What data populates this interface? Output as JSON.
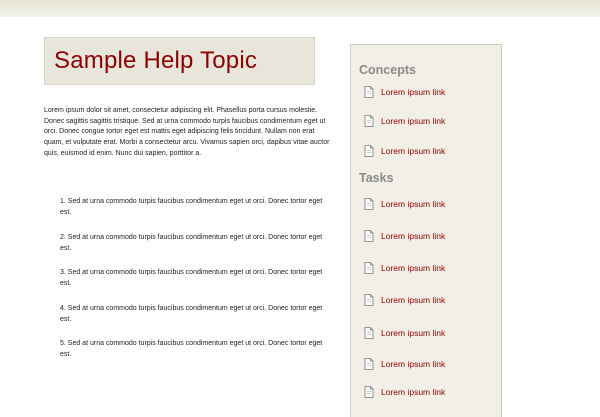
{
  "main": {
    "title": "Sample Help Topic",
    "intro": "Lorem ipsum dolor sit amet, consectetur adipiscing elit. Phasellus porta cursus molestie. Donec sagittis sagittis tristique. Sed at urna commodo turpis faucibus condimentum eget ut orci. Donec congue tortor eget est mattis eget adipiscing felis tincidunt. Nullam non erat quam, et vulputate erat. Morbi a consectetur arcu. Vivamus sapien orci, dapibus vitae auctor quis, euismod id enim. Nunc dui sapien, porttitor a.",
    "steps": [
      "1. Sed at urna commodo turpis faucibus condimentum eget ut orci. Donec tortor eget est.",
      "2. Sed at urna commodo turpis faucibus condimentum eget ut orci. Donec tortor eget est.",
      "3. Sed at urna commodo turpis faucibus condimentum eget ut orci. Donec tortor eget est.",
      "4. Sed at urna commodo turpis faucibus condimentum eget ut orci. Donec tortor eget est.",
      "5. Sed at urna commodo turpis faucibus condimentum eget ut orci. Donec tortor eget est."
    ]
  },
  "sidebar": {
    "concepts": {
      "heading": "Concepts",
      "links": [
        "Lorem ipsum link",
        "Lorem ipsum link",
        "Lorem ipsum link"
      ]
    },
    "tasks": {
      "heading": "Tasks",
      "links": [
        "Lorem ipsum link",
        "Lorem ipsum link",
        "Lorem ipsum link",
        "Lorem ipsum link",
        "Lorem ipsum link",
        "Lorem ipsum link",
        "Lorem ipsum link"
      ]
    },
    "link_icon": "document-icon"
  },
  "colors": {
    "title": "#8b0000",
    "link": "#8b0000",
    "heading": "#8a8a8a",
    "title_box_bg": "#e8e5da",
    "sidebar_bg": "#f1efe6"
  }
}
